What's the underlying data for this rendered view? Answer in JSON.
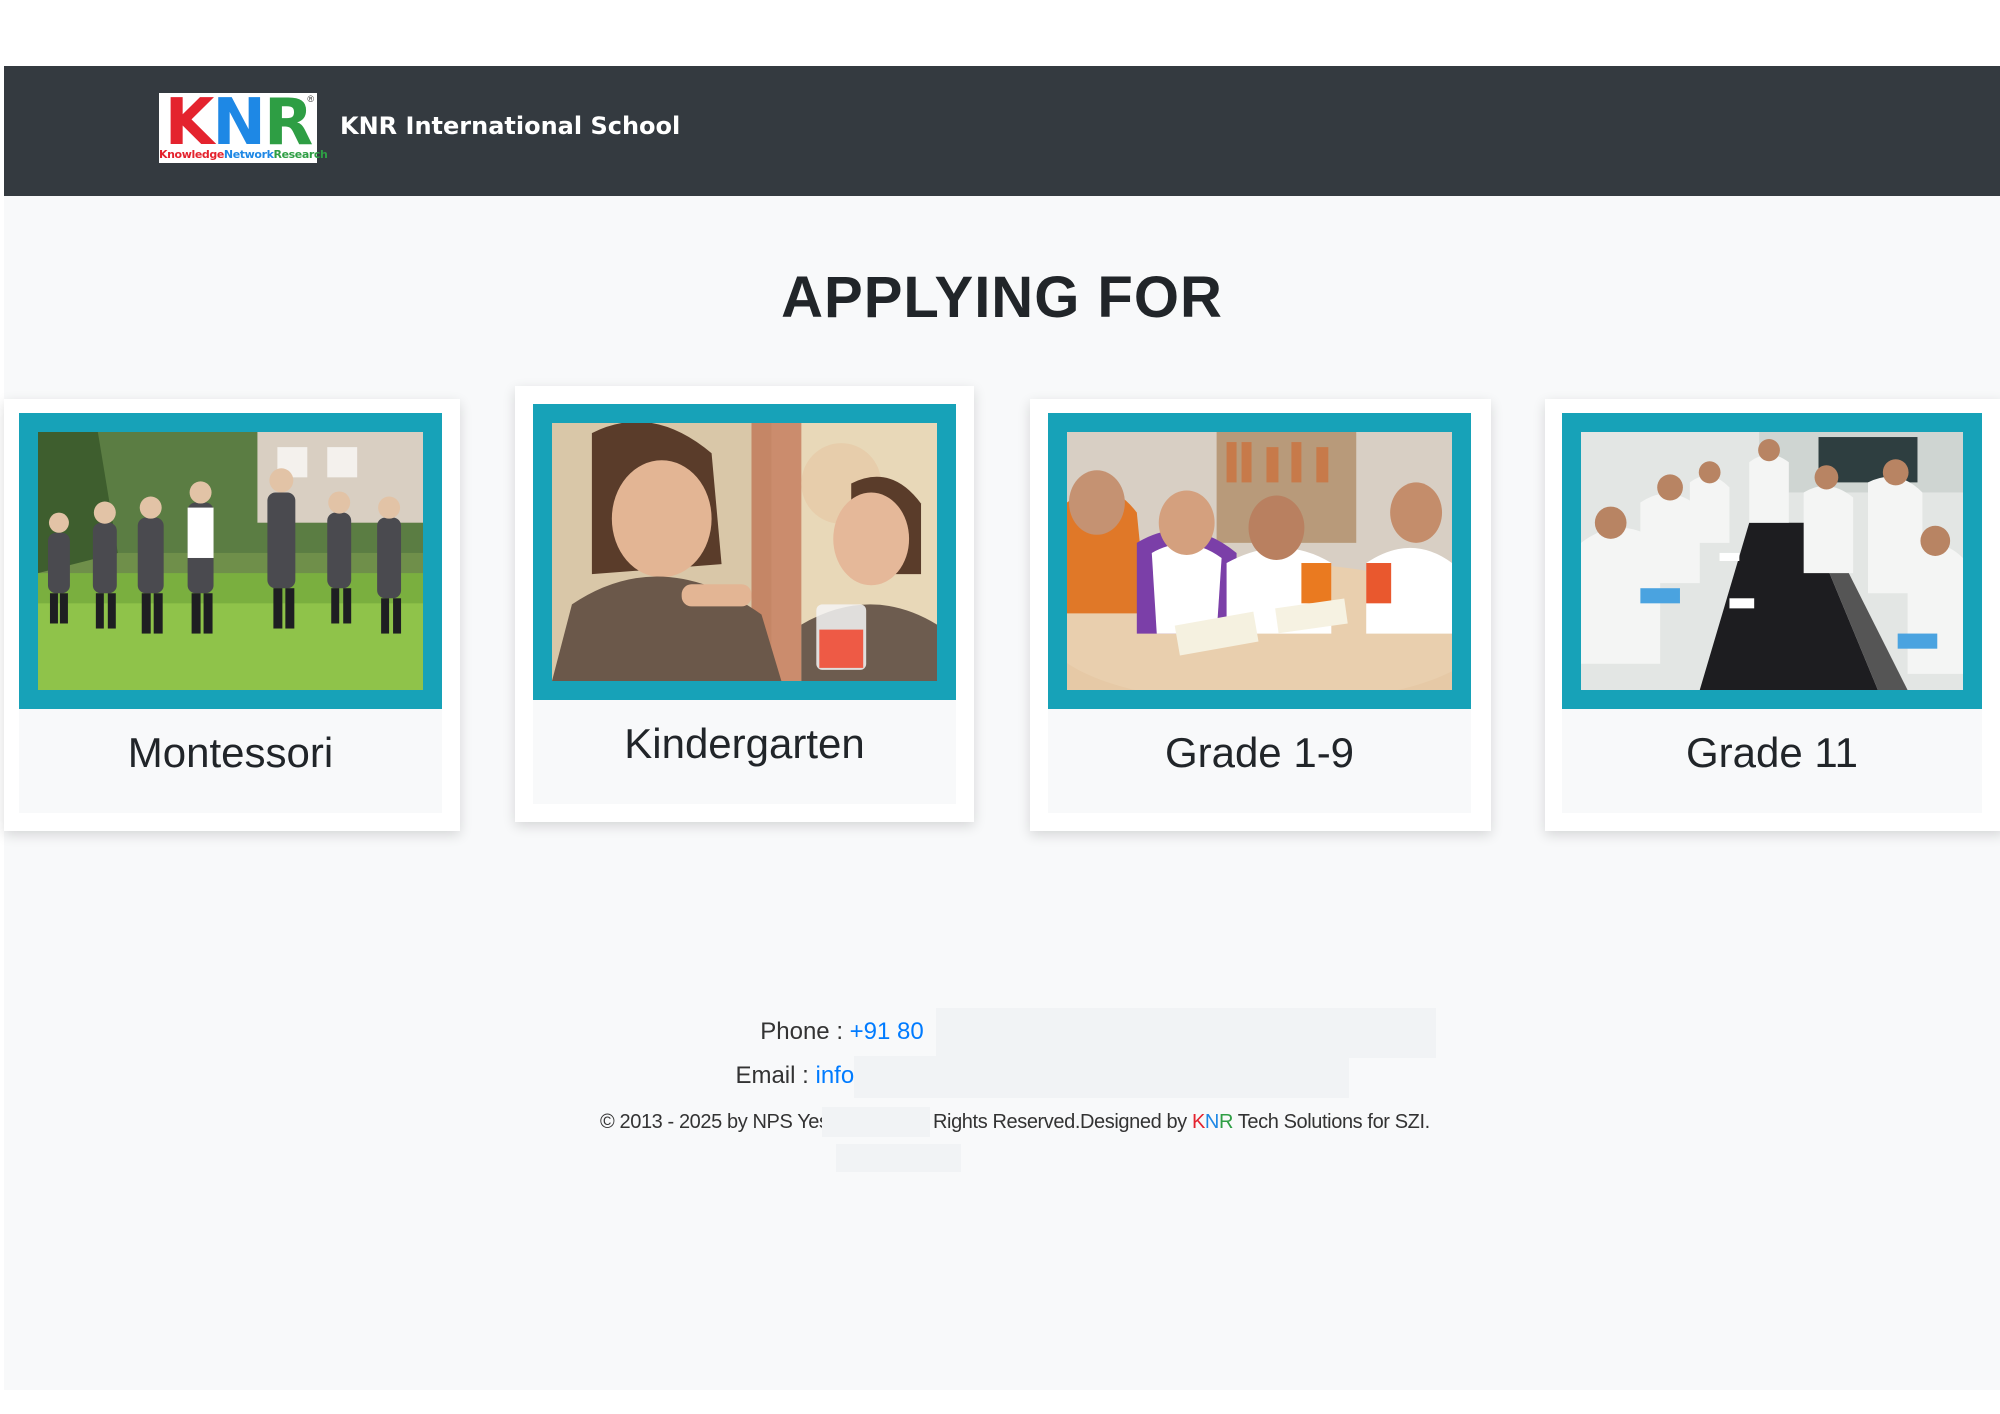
{
  "navbar": {
    "brand_name": "KNR International School",
    "logo": {
      "letters": [
        "K",
        "N",
        "R"
      ],
      "tagline_words": [
        "Knowledge",
        "Network",
        "Research"
      ],
      "reg_mark": "®",
      "colors": {
        "k": "#e4232e",
        "n": "#1e88e5",
        "r": "#2e9e44"
      }
    }
  },
  "main": {
    "heading": "APPLYING FOR",
    "programs": [
      {
        "label": "Montessori",
        "image": "children-playing-outdoors"
      },
      {
        "label": "Kindergarten",
        "image": "girl-with-juice-cup"
      },
      {
        "label": "Grade 1-9",
        "image": "students-reading-at-table"
      },
      {
        "label": "Grade 11",
        "image": "students-in-science-lab"
      }
    ]
  },
  "footer": {
    "phone_label": "Phone :",
    "phone_value": "+91 80",
    "email_label": "Email :",
    "email_value": "info@",
    "copyright_prefix": "© 2013 - 2025 by NPS Yes",
    "copyright_middle": "Rights Reserved.Designed by",
    "copyright_brand": [
      "K",
      "N",
      "R"
    ],
    "copyright_suffix": "Tech Solutions for SZI."
  },
  "colors": {
    "navbar": "#343a40",
    "page_background": "#f8f9fa",
    "frame_accent": "#17a2b8",
    "link": "#007bff"
  }
}
